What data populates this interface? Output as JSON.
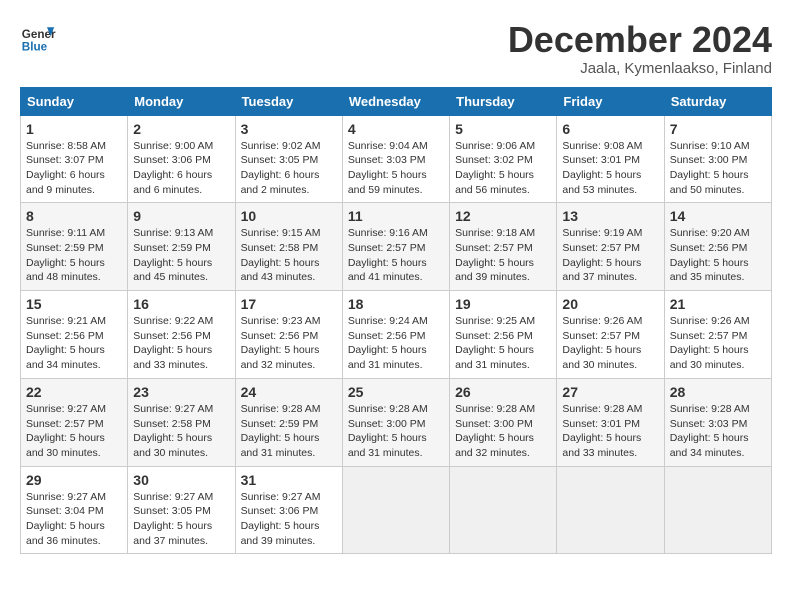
{
  "logo": {
    "line1": "General",
    "line2": "Blue"
  },
  "title": "December 2024",
  "location": "Jaala, Kymenlaakso, Finland",
  "weekdays": [
    "Sunday",
    "Monday",
    "Tuesday",
    "Wednesday",
    "Thursday",
    "Friday",
    "Saturday"
  ],
  "weeks": [
    [
      {
        "day": "1",
        "info": "Sunrise: 8:58 AM\nSunset: 3:07 PM\nDaylight: 6 hours\nand 9 minutes."
      },
      {
        "day": "2",
        "info": "Sunrise: 9:00 AM\nSunset: 3:06 PM\nDaylight: 6 hours\nand 6 minutes."
      },
      {
        "day": "3",
        "info": "Sunrise: 9:02 AM\nSunset: 3:05 PM\nDaylight: 6 hours\nand 2 minutes."
      },
      {
        "day": "4",
        "info": "Sunrise: 9:04 AM\nSunset: 3:03 PM\nDaylight: 5 hours\nand 59 minutes."
      },
      {
        "day": "5",
        "info": "Sunrise: 9:06 AM\nSunset: 3:02 PM\nDaylight: 5 hours\nand 56 minutes."
      },
      {
        "day": "6",
        "info": "Sunrise: 9:08 AM\nSunset: 3:01 PM\nDaylight: 5 hours\nand 53 minutes."
      },
      {
        "day": "7",
        "info": "Sunrise: 9:10 AM\nSunset: 3:00 PM\nDaylight: 5 hours\nand 50 minutes."
      }
    ],
    [
      {
        "day": "8",
        "info": "Sunrise: 9:11 AM\nSunset: 2:59 PM\nDaylight: 5 hours\nand 48 minutes."
      },
      {
        "day": "9",
        "info": "Sunrise: 9:13 AM\nSunset: 2:59 PM\nDaylight: 5 hours\nand 45 minutes."
      },
      {
        "day": "10",
        "info": "Sunrise: 9:15 AM\nSunset: 2:58 PM\nDaylight: 5 hours\nand 43 minutes."
      },
      {
        "day": "11",
        "info": "Sunrise: 9:16 AM\nSunset: 2:57 PM\nDaylight: 5 hours\nand 41 minutes."
      },
      {
        "day": "12",
        "info": "Sunrise: 9:18 AM\nSunset: 2:57 PM\nDaylight: 5 hours\nand 39 minutes."
      },
      {
        "day": "13",
        "info": "Sunrise: 9:19 AM\nSunset: 2:57 PM\nDaylight: 5 hours\nand 37 minutes."
      },
      {
        "day": "14",
        "info": "Sunrise: 9:20 AM\nSunset: 2:56 PM\nDaylight: 5 hours\nand 35 minutes."
      }
    ],
    [
      {
        "day": "15",
        "info": "Sunrise: 9:21 AM\nSunset: 2:56 PM\nDaylight: 5 hours\nand 34 minutes."
      },
      {
        "day": "16",
        "info": "Sunrise: 9:22 AM\nSunset: 2:56 PM\nDaylight: 5 hours\nand 33 minutes."
      },
      {
        "day": "17",
        "info": "Sunrise: 9:23 AM\nSunset: 2:56 PM\nDaylight: 5 hours\nand 32 minutes."
      },
      {
        "day": "18",
        "info": "Sunrise: 9:24 AM\nSunset: 2:56 PM\nDaylight: 5 hours\nand 31 minutes."
      },
      {
        "day": "19",
        "info": "Sunrise: 9:25 AM\nSunset: 2:56 PM\nDaylight: 5 hours\nand 31 minutes."
      },
      {
        "day": "20",
        "info": "Sunrise: 9:26 AM\nSunset: 2:57 PM\nDaylight: 5 hours\nand 30 minutes."
      },
      {
        "day": "21",
        "info": "Sunrise: 9:26 AM\nSunset: 2:57 PM\nDaylight: 5 hours\nand 30 minutes."
      }
    ],
    [
      {
        "day": "22",
        "info": "Sunrise: 9:27 AM\nSunset: 2:57 PM\nDaylight: 5 hours\nand 30 minutes."
      },
      {
        "day": "23",
        "info": "Sunrise: 9:27 AM\nSunset: 2:58 PM\nDaylight: 5 hours\nand 30 minutes."
      },
      {
        "day": "24",
        "info": "Sunrise: 9:28 AM\nSunset: 2:59 PM\nDaylight: 5 hours\nand 31 minutes."
      },
      {
        "day": "25",
        "info": "Sunrise: 9:28 AM\nSunset: 3:00 PM\nDaylight: 5 hours\nand 31 minutes."
      },
      {
        "day": "26",
        "info": "Sunrise: 9:28 AM\nSunset: 3:00 PM\nDaylight: 5 hours\nand 32 minutes."
      },
      {
        "day": "27",
        "info": "Sunrise: 9:28 AM\nSunset: 3:01 PM\nDaylight: 5 hours\nand 33 minutes."
      },
      {
        "day": "28",
        "info": "Sunrise: 9:28 AM\nSunset: 3:03 PM\nDaylight: 5 hours\nand 34 minutes."
      }
    ],
    [
      {
        "day": "29",
        "info": "Sunrise: 9:27 AM\nSunset: 3:04 PM\nDaylight: 5 hours\nand 36 minutes."
      },
      {
        "day": "30",
        "info": "Sunrise: 9:27 AM\nSunset: 3:05 PM\nDaylight: 5 hours\nand 37 minutes."
      },
      {
        "day": "31",
        "info": "Sunrise: 9:27 AM\nSunset: 3:06 PM\nDaylight: 5 hours\nand 39 minutes."
      },
      null,
      null,
      null,
      null
    ]
  ]
}
